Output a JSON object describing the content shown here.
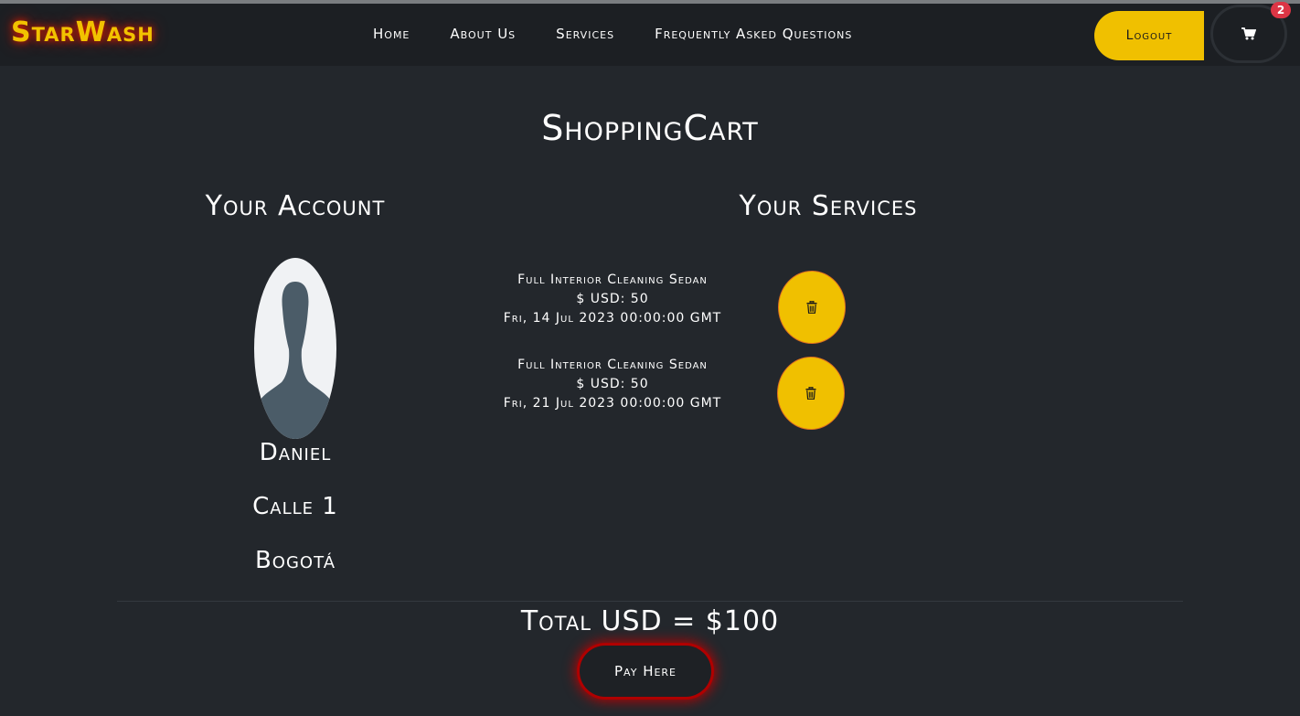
{
  "brand": "StarWash",
  "nav": {
    "links": [
      "Home",
      "About Us",
      "Services",
      "Frequently Asked Questions"
    ],
    "logout_label": "Logout",
    "cart_count": "2"
  },
  "page_title": "ShoppingCart",
  "account": {
    "heading": "Your Account",
    "name": "Daniel",
    "address": "Calle 1",
    "city": "Bogotá"
  },
  "services": {
    "heading": "Your Services",
    "items": [
      {
        "name": "Full Interior Cleaning Sedan",
        "price": "$ USD: 50",
        "date": "Fri, 14 Jul 2023 00:00:00 GMT"
      },
      {
        "name": "Full Interior Cleaning Sedan",
        "price": "$ USD: 50",
        "date": "Fri, 21 Jul 2023 00:00:00 GMT"
      }
    ]
  },
  "total": "Total USD = $100",
  "pay_label": "Pay Here",
  "colors": {
    "background": "#23272c",
    "navbar": "#1c1f23",
    "accent": "#f0c000",
    "glow": "#c00000",
    "badge": "#dc3545"
  },
  "icons": {
    "cart": "cart-icon",
    "trash": "trash-icon",
    "avatar": "user-silhouette-icon"
  }
}
